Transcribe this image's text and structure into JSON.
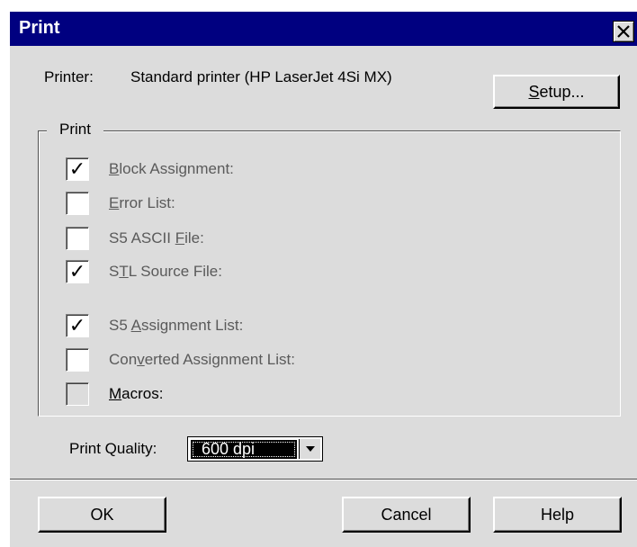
{
  "window": {
    "title": "Print"
  },
  "printer": {
    "label": "Printer:",
    "value": "Standard printer (HP LaserJet 4Si MX)"
  },
  "buttons": {
    "setup": {
      "mnemonic": "S",
      "rest": "etup..."
    },
    "ok": "OK",
    "cancel": "Cancel",
    "help": "Help"
  },
  "group": {
    "legend": "Print",
    "items": [
      {
        "pre": "",
        "mn": "B",
        "post": "lock Assignment:",
        "checked": true,
        "disabled": false
      },
      {
        "pre": "",
        "mn": "E",
        "post": "rror List:",
        "checked": false,
        "disabled": false
      },
      {
        "pre": "S5 ASCII ",
        "mn": "F",
        "post": "ile:",
        "checked": false,
        "disabled": false
      },
      {
        "pre": "S",
        "mn": "T",
        "post": "L Source File:",
        "checked": true,
        "disabled": false
      },
      {
        "pre": "S5 ",
        "mn": "A",
        "post": "ssignment List:",
        "checked": true,
        "disabled": false
      },
      {
        "pre": "Con",
        "mn": "v",
        "post": "erted Assignment List:",
        "checked": false,
        "disabled": false
      },
      {
        "pre": "",
        "mn": "M",
        "post": "acros:",
        "checked": false,
        "disabled": true
      }
    ]
  },
  "quality": {
    "label": "Print Quality:",
    "value": "600 dpi"
  },
  "icons": {
    "close": "close-icon",
    "check": "check-icon",
    "dropdown": "dropdown-arrow-icon"
  },
  "colors": {
    "titlebar": "#000080",
    "dialog_bg": "#dcdcdc"
  }
}
